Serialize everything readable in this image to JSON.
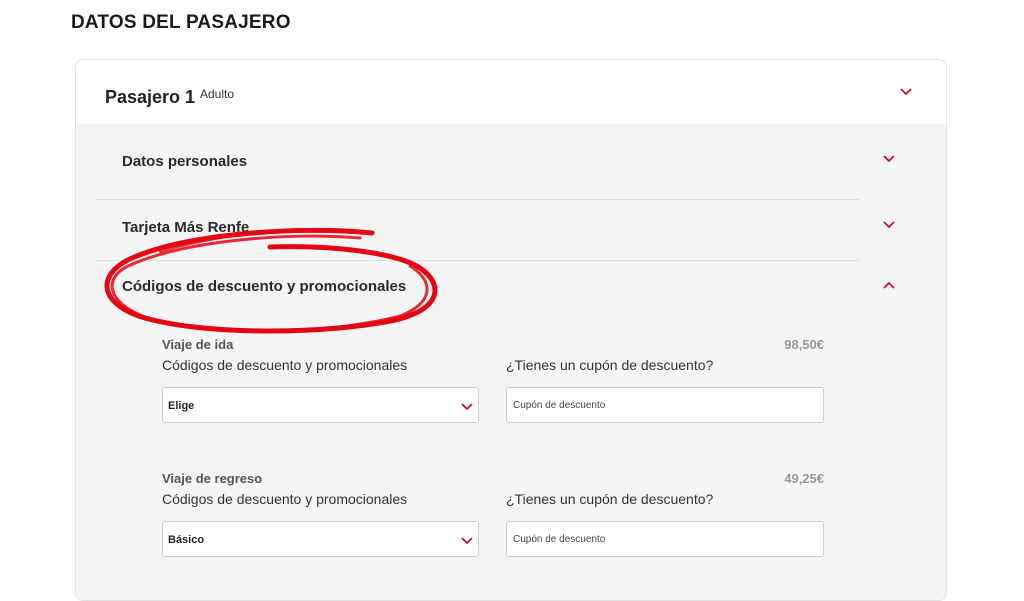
{
  "page": {
    "title": "DATOS DEL PASAJERO"
  },
  "passenger": {
    "name": "Pasajero 1",
    "type": "Adulto"
  },
  "sections": {
    "personal": "Datos personales",
    "card": "Tarjeta Más Renfe",
    "codes": "Códigos de descuento y promocionales"
  },
  "trips": [
    {
      "label": "Viaje de ida",
      "price": "98,50€",
      "codes_label": "Códigos de descuento y promocionales",
      "coupon_label": "¿Tienes un cupón de descuento?",
      "select_value": "Elige",
      "coupon_placeholder": "Cupón de descuento"
    },
    {
      "label": "Viaje de regreso",
      "price": "49,25€",
      "codes_label": "Códigos de descuento y promocionales",
      "coupon_label": "¿Tienes un cupón de descuento?",
      "select_value": "Básico",
      "coupon_placeholder": "Cupón de descuento"
    }
  ],
  "colors": {
    "accent": "#c8102e",
    "annotation": "#e30613"
  }
}
